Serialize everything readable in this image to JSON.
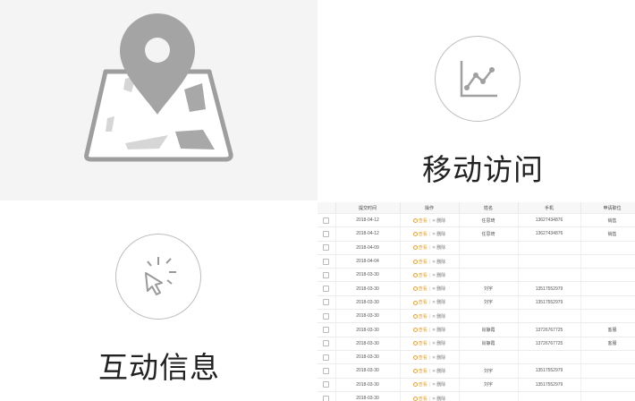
{
  "panels": {
    "map": {
      "icon": "map-pin-icon"
    },
    "mobile": {
      "icon": "line-chart-icon",
      "label": "移动访问"
    },
    "interact": {
      "icon": "click-cursor-icon",
      "label": "互动信息"
    }
  },
  "table": {
    "headers": [
      "",
      "提交时间",
      "操作",
      "姓名",
      "手机",
      "申请职位"
    ],
    "view_label": "查看",
    "delete_label": "删除",
    "rows": [
      {
        "date": "2018-04-12",
        "name": "任思琦",
        "phone": "13627434876",
        "job": "销售"
      },
      {
        "date": "2018-04-12",
        "name": "任思琦",
        "phone": "13627434876",
        "job": "销售"
      },
      {
        "date": "2018-04-09",
        "name": "",
        "phone": "",
        "job": ""
      },
      {
        "date": "2018-04-04",
        "name": "",
        "phone": "",
        "job": ""
      },
      {
        "date": "2018-03-30",
        "name": "",
        "phone": "",
        "job": ""
      },
      {
        "date": "2018-03-30",
        "name": "刘宇",
        "phone": "13517552979",
        "job": ""
      },
      {
        "date": "2018-03-30",
        "name": "刘宇",
        "phone": "13517552979",
        "job": ""
      },
      {
        "date": "2018-03-30",
        "name": "",
        "phone": "",
        "job": ""
      },
      {
        "date": "2018-03-30",
        "name": "肖静霞",
        "phone": "13726767725",
        "job": "客服"
      },
      {
        "date": "2018-03-30",
        "name": "肖静霞",
        "phone": "13726767725",
        "job": "客服"
      },
      {
        "date": "2018-03-30",
        "name": "",
        "phone": "",
        "job": ""
      },
      {
        "date": "2018-03-30",
        "name": "刘宇",
        "phone": "13517552979",
        "job": ""
      },
      {
        "date": "2018-03-30",
        "name": "刘宇",
        "phone": "13517552979",
        "job": ""
      },
      {
        "date": "2018-03-30",
        "name": "",
        "phone": "",
        "job": ""
      }
    ]
  }
}
